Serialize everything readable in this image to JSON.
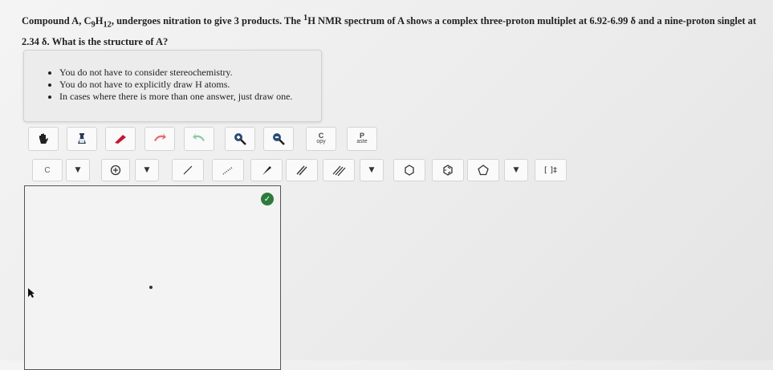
{
  "question": {
    "part1": "Compound A, C",
    "sub1": "9",
    "part2": "H",
    "sub2": "12",
    "part3": ", undergoes nitration to give 3 products. The ",
    "sup1": "1",
    "part4": "H NMR spectrum of A shows a complex three-proton multiplet at 6.92-6.99 δ and a nine-proton singlet at 2.34 δ. What is the structure of A?"
  },
  "notes": [
    "You do not have to consider stereochemistry.",
    "You do not have to explicitly draw H atoms.",
    "In cases where there is more than one answer, just draw one."
  ],
  "toolbar1": {
    "copy_top": "C",
    "copy_bottom": "opy",
    "paste_top": "P",
    "paste_bottom": "aste"
  },
  "toolbar2": {
    "element_label": "C",
    "dropdown_arrow": "▼",
    "bracket_label": "[ ]‡"
  },
  "colors": {
    "eraser": "#c4162f",
    "lasso": "#e86b6b",
    "arrow_green": "#8ec9a0",
    "zoom": "#2b4d7a",
    "status": "#2d7a3a"
  }
}
